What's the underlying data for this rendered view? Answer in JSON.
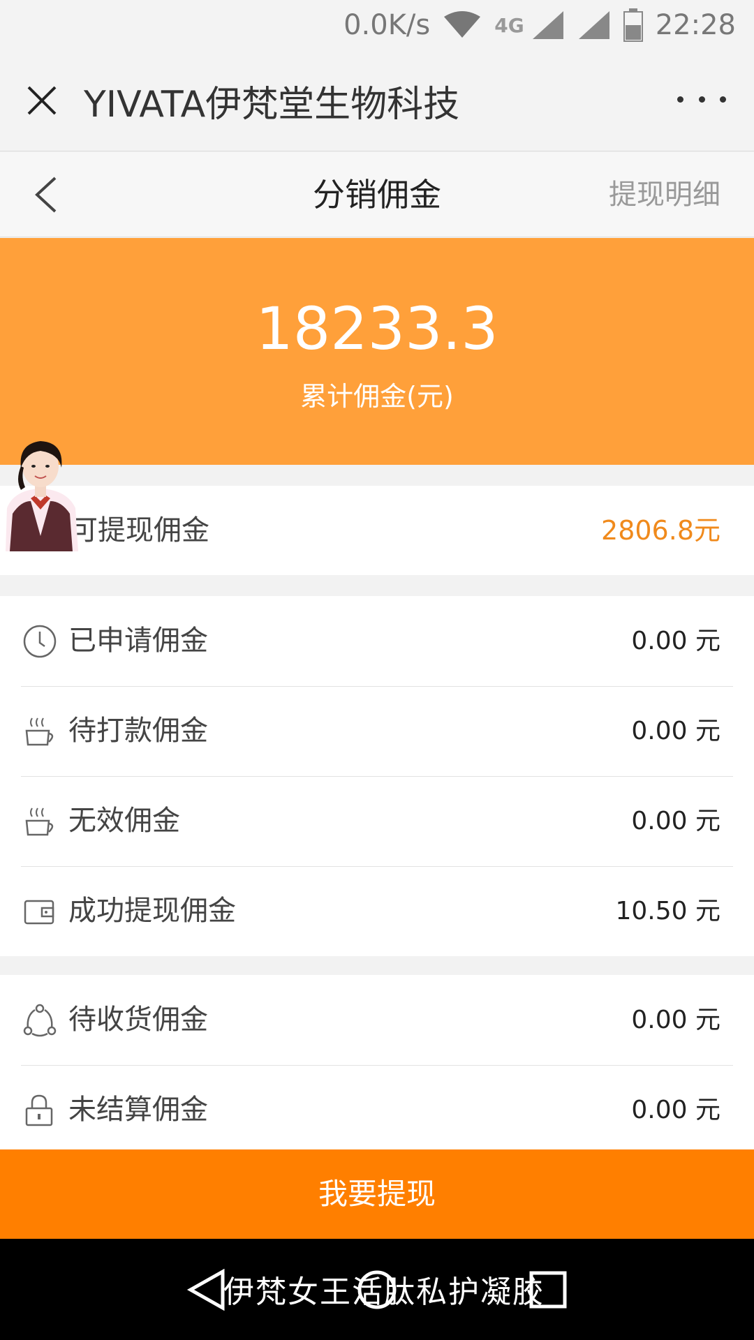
{
  "status_bar": {
    "speed": "0.0K/s",
    "network": "4G",
    "time": "22:28"
  },
  "wechat_bar": {
    "title": "YIVATA伊梵堂生物科技"
  },
  "nav": {
    "title": "分销佣金",
    "detail_link": "提现明细"
  },
  "summary": {
    "total": "18233.3",
    "total_label": "累计佣金(元)"
  },
  "withdrawable": {
    "label": "可提现佣金",
    "value": "2806.8元"
  },
  "group1": [
    {
      "icon": "clock-icon",
      "label": "已申请佣金",
      "value": "0.00 元"
    },
    {
      "icon": "coffee-cup-icon",
      "label": "待打款佣金",
      "value": "0.00 元"
    },
    {
      "icon": "coffee-cup-icon",
      "label": "无效佣金",
      "value": "0.00 元"
    },
    {
      "icon": "wallet-icon",
      "label": "成功提现佣金",
      "value": "10.50 元"
    }
  ],
  "group2": [
    {
      "icon": "share-icon",
      "label": "待收货佣金",
      "value": "0.00 元"
    },
    {
      "icon": "lock-icon",
      "label": "未结算佣金",
      "value": "0.00 元"
    }
  ],
  "withdraw_button": {
    "label": "我要提现"
  },
  "system_nav": {
    "overlay_text": "伊梵女王活肽私护凝胶"
  },
  "colors": {
    "banner": "#ffa03a",
    "button": "#ff7f00",
    "accent_value": "#f08a1c"
  }
}
